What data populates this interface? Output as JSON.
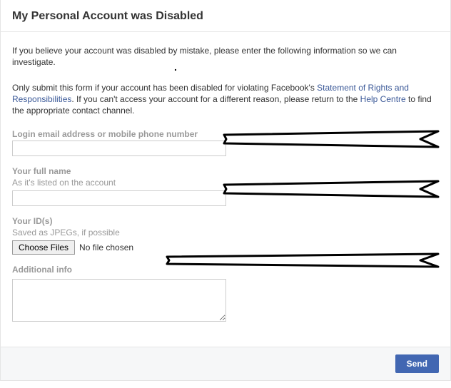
{
  "header": {
    "title": "My Personal Account was Disabled"
  },
  "intro": "If you believe your account was disabled by mistake, please enter the following information so we can investigate.",
  "note": {
    "pre": "Only submit this form if your account has been disabled for violating Facebook's ",
    "link1": "Statement of Rights and Responsibilities",
    "mid": ". If you can't access your account for a different reason, please return to the ",
    "link2": "Help Centre",
    "post": " to find the appropriate contact channel."
  },
  "fields": {
    "login": {
      "label": "Login email address or mobile phone number"
    },
    "fullname": {
      "label": "Your full name",
      "sublabel": "As it's listed on the account"
    },
    "ids": {
      "label": "Your ID(s)",
      "sublabel": "Saved as JPEGs, if possible",
      "button": "Choose Files",
      "nofile": "No file chosen"
    },
    "additional": {
      "label": "Additional info"
    }
  },
  "footer": {
    "send": "Send"
  }
}
